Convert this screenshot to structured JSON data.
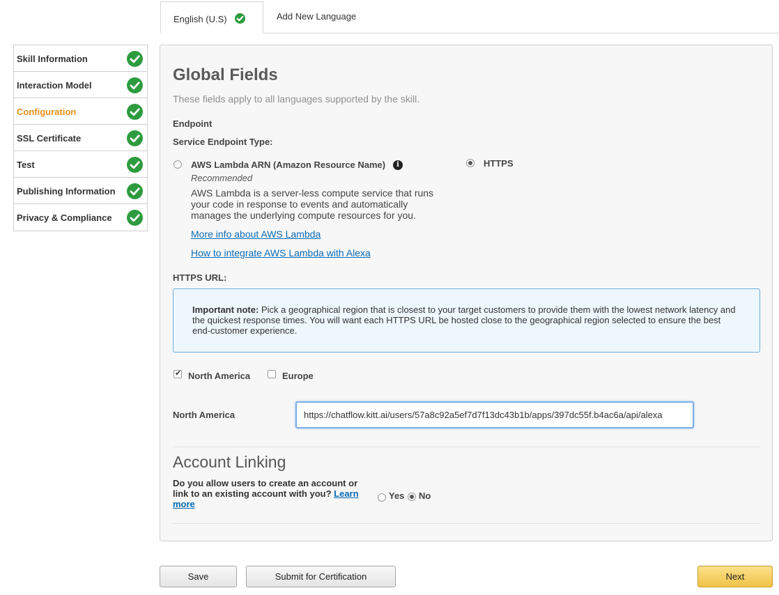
{
  "tabs": {
    "active_label": "English (U.S)",
    "add_label": "Add New Language"
  },
  "sidebar": {
    "items": [
      {
        "label": "Skill Information",
        "complete": true
      },
      {
        "label": "Interaction Model",
        "complete": true
      },
      {
        "label": "Configuration",
        "complete": true,
        "active": true
      },
      {
        "label": "SSL Certificate",
        "complete": true
      },
      {
        "label": "Test",
        "complete": true
      },
      {
        "label": "Publishing Information",
        "complete": true
      },
      {
        "label": "Privacy & Compliance",
        "complete": true
      }
    ]
  },
  "global": {
    "title": "Global Fields",
    "subtitle": "These fields apply to all languages supported by the skill.",
    "endpoint_label": "Endpoint",
    "service_type_label": "Service Endpoint Type:",
    "lambda": {
      "label": "AWS Lambda ARN (Amazon Resource Name)",
      "recommended": "Recommended",
      "description": "AWS Lambda is a server-less compute service that runs your code in response to events and automatically manages the underlying compute resources for you.",
      "link_more": "More info about AWS Lambda",
      "link_integrate": "How to integrate AWS Lambda with Alexa",
      "selected": false
    },
    "https": {
      "label": "HTTPS",
      "selected": true
    },
    "https_url_label": "HTTPS URL:",
    "note": {
      "bold": "Important note:",
      "text": " Pick a geographical region that is closest to your target customers to provide them with the lowest network latency and the quickest response times. You will want each HTTPS URL be hosted close to the geographical region selected to ensure the best end-customer experience."
    },
    "regions": {
      "north_america": {
        "label": "North America",
        "checked": true
      },
      "europe": {
        "label": "Europe",
        "checked": false
      }
    },
    "url_field": {
      "label": "North America",
      "value": "https://chatflow.kitt.ai/users/57a8c92a5ef7d7f13dc43b1b/apps/397dc55f.b4ac6a/api/alexa"
    }
  },
  "account_linking": {
    "title": "Account Linking",
    "question": "Do you allow users to create an account or link to an existing account with you?",
    "learn_more": "Learn more",
    "yes_label": "Yes",
    "no_label": "No",
    "selected": "No"
  },
  "footer": {
    "save_label": "Save",
    "submit_label": "Submit for Certification",
    "next_label": "Next"
  },
  "colors": {
    "accent_active": "#e4901c",
    "complete_green": "#2e9b3f",
    "link_blue": "#0a6bb3",
    "next_button": "#f1c447"
  }
}
